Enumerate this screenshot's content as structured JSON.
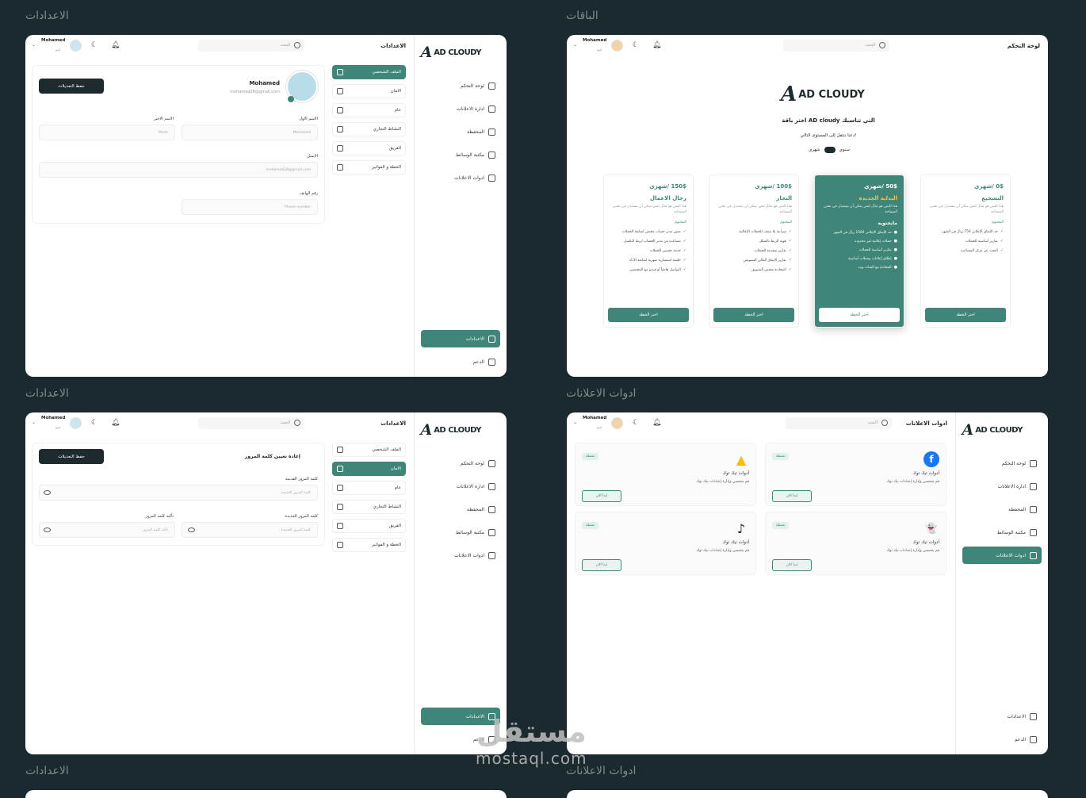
{
  "section_titles": [
    "الاعدادات",
    "الباقات",
    "الاعدادات",
    "ادوات الاعلانات",
    "الاعدادات",
    "ادوات الاعلانات"
  ],
  "logo": {
    "mark": "A",
    "text": "AD CLOUDY"
  },
  "nav": [
    {
      "label": "لوحة التحكم",
      "icon": "home-icon"
    },
    {
      "label": "ادارة الاعلانات",
      "icon": "bar-chart-icon"
    },
    {
      "label": "المحفظة",
      "icon": "wallet-icon"
    },
    {
      "label": "مكتبة الوسائط",
      "icon": "media-library-icon"
    },
    {
      "label": "ادوات الاعلانات",
      "icon": "flag-icon"
    }
  ],
  "nav_bottom": {
    "settings": "الاعدادات",
    "support": "الدعم"
  },
  "topbar": {
    "titles": {
      "settings": "الاعدادات",
      "dashboard": "لوحة التحكم",
      "tools": "ادوات الاعلانات"
    },
    "search_placeholder": "البحث",
    "user_name": "Mohamed",
    "user_sub": "اوﺑﻮ"
  },
  "settings_tabs": [
    "الملف الشخصي",
    "الامان",
    "عام",
    "النشاط التجاري",
    "الفريق",
    "الخطة و الفواتير"
  ],
  "profile": {
    "name": "Mohamed",
    "email": "mohamed28@gmail.com",
    "save_label": "حفظ التعديلات",
    "first_name_label": "الاسم الاول",
    "first_name_value": "Mohamed",
    "last_name_label": "الاسم الاخير",
    "last_name_value": "Mosh",
    "email_label": "الايميل",
    "email_value": "mohamed28@gmail.com",
    "phone_label": "رقم الهاتف",
    "phone_placeholder": "Phone number"
  },
  "security": {
    "title": "إعادة تعيين كلمة المرور",
    "save_label": "حفظ التعديلات",
    "old_label": "كلمة المرور القديمة",
    "old_placeholder": "كلمة المرور القديمة",
    "new_label": "كلمة المرور الجديدة",
    "new_placeholder": "كلمة المرور الجديدة",
    "confirm_label": "تأكيد كلمة المرور",
    "confirm_placeholder": "تأكيد كلمة المرور"
  },
  "plans": {
    "title": "اختر باقة AD cloudy التي تناسبك",
    "subtitle": "دعنا ننتقل إلى المستوى التالي!",
    "toggle_yearly": "سنوي",
    "toggle_monthly": "شهري",
    "items": [
      {
        "price": "0$ /شهري",
        "name": "التشجيع",
        "desc": "هذا النص هو مثال لنص يمكن أن يستبدل في نفس المساحة",
        "content_head": "المحتوى",
        "features": [
          "حد الإنفاق الإعلاني 750 ريال في الشهر",
          "تقارير أساسية للحملات",
          "البحث عن مركز المساعدة"
        ],
        "button": "اختر الخطة"
      },
      {
        "price": "50$ /شهري",
        "name": "البداية الجديدة",
        "desc": "هذا النص هو مثال لنص يمكن أن يستبدل في نفس المساحة",
        "content_head": "مايحتويه",
        "features": [
          "حد الإنفاق الإعلاني 1500 ريال في الشهر",
          "حملات إعلانية غير محدودة",
          "تقارير أساسية للحملات",
          "إطلاق إعلانات وحملات أساسية",
          "المحادثة مع الشات بوت"
        ],
        "button": "اختر الخطة"
      },
      {
        "price": "100$ /شهري",
        "name": "التجار",
        "desc": "هذا النص هو مثال لنص يمكن أن يستبدل في نفس المساحة",
        "content_head": "المحتوى",
        "features": [
          "ميزانية بلا سقف للحملات الإعلانية",
          "هوية الربط بالشكل",
          "تقارير متقدمة للحملات",
          "تقارير الإنفاق المالي التسويقي",
          "المحادثة مختص التسويق"
        ],
        "button": "اختر الخطة"
      },
      {
        "price": "150$ /شهري",
        "name": "رجال الاعمال",
        "desc": "هذا النص هو مثال لنص يمكن أن يستبدل في نفس المساحة",
        "content_head": "المحتوى",
        "features": [
          "تعيين مدير حساب مختص لمتابعة الحملات",
          "مساعدة من مدير الحساب لربط البكسل",
          "خدمة تحسين الحملات",
          "جلسة استشارية شهرية لمتابعة الأداء",
          "التواصل هاتفياً أو فيديو مع المختصين"
        ],
        "button": "اختر الخطة"
      }
    ]
  },
  "tools": [
    {
      "icon": "facebook-icon",
      "glyph": "f",
      "color": "#1877f2",
      "title": "أدوات تيك توك",
      "desc": "قم بتحسين وإدارة إعدادات تيك توك",
      "badge": "نشطة",
      "button": "ابدأ الان"
    },
    {
      "icon": "google-ads-icon",
      "glyph": "▲",
      "color": "#fbbc04",
      "title": "أدوات تيك توك",
      "desc": "قم بتحسين وإدارة إعدادات تيك توك",
      "badge": "نشطة",
      "button": "ابدأ الان"
    },
    {
      "icon": "snapchat-icon",
      "glyph": "👻",
      "color": "#222222",
      "title": "أدوات تيك توك",
      "desc": "قم بتحسين وإدارة إعدادات تيك توك",
      "badge": "نشطة",
      "button": "ابدأ الان"
    },
    {
      "icon": "tiktok-icon",
      "glyph": "♪",
      "color": "#000000",
      "title": "أدوات تيك توك",
      "desc": "قم بتحسين وإدارة إعدادات تيك توك",
      "badge": "نشطة",
      "button": "ابدأ الان"
    }
  ],
  "watermark": {
    "arabic": "مستقل",
    "latin": "mostaql.com"
  },
  "colors": {
    "accent": "#3f8578",
    "dark": "#1d2b2e",
    "bg": "#1b2a2e"
  }
}
